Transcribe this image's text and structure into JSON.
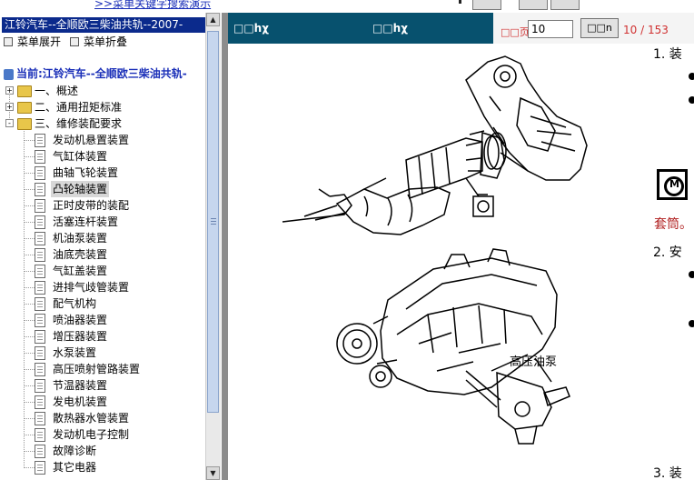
{
  "top_bar": {
    "link_text": ">>菜单关键字搜索演示"
  },
  "left_panel": {
    "title": "江铃汽车--全顺欧三柴油共轨--2007-",
    "expand_label": "菜单展开",
    "collapse_label": "菜单折叠",
    "current_label": "当前:江铃汽车--全顺欧三柴油共轨-",
    "folders": [
      {
        "label": "一、概述",
        "toggle": "+"
      },
      {
        "label": "二、通用扭矩标准",
        "toggle": "+"
      },
      {
        "label": "三、维修装配要求",
        "toggle": "-"
      }
    ],
    "items": [
      "发动机悬置装置",
      "气缸体装置",
      "曲轴飞轮装置",
      "凸轮轴装置",
      "正时皮带的装配",
      "活塞连杆装置",
      "机油泵装置",
      "油底壳装置",
      "气缸盖装置",
      "进排气歧管装置",
      "配气机构",
      "喷油器装置",
      "增压器装置",
      "水泵装置",
      "高压喷射管路装置",
      "节温器装置",
      "发电机装置",
      "散热器水管装置",
      "发动机电子控制",
      "故障诊断",
      "其它电器"
    ],
    "selected_index": 3
  },
  "viewer": {
    "header_left": "□□hχ",
    "header_right": "□□hχ",
    "page_label": "□□页",
    "page_input_value": "10",
    "go_button_label": "□□n",
    "page_count": "10 / 153"
  },
  "document": {
    "caption": "高压油泵",
    "step1": "1.  装",
    "step2": "2.  安",
    "step3": "3.  装",
    "red_text": "套筒。"
  },
  "colors": {
    "panel_title_bg": "#0b2a8c",
    "viewer_header_bg": "#07516e",
    "red_text": "#b02020",
    "link": "#1a2fb8"
  }
}
